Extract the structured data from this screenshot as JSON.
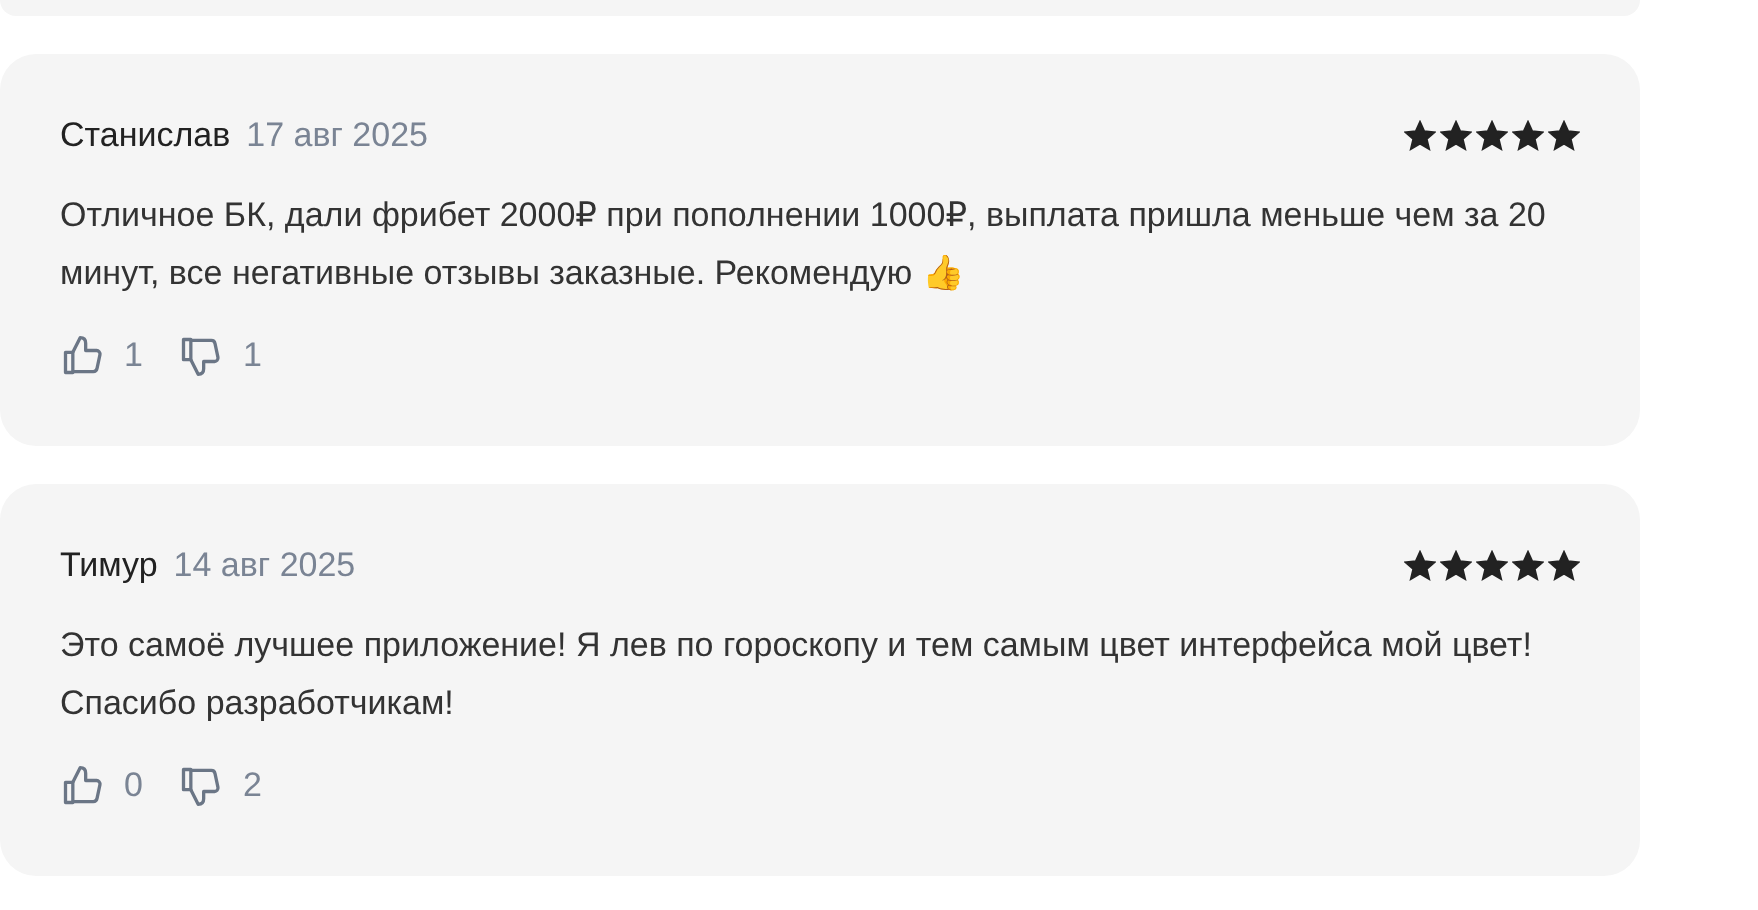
{
  "reviews": [
    {
      "author": "Станислав",
      "date": "17 авг 2025",
      "stars": 5,
      "text": "Отличное БК, дали фрибет 2000₽ при пополнении 1000₽, выплата пришла меньше чем за 20 минут, все негативные отзывы заказные. Рекомендую 👍",
      "likes": "1",
      "dislikes": "1"
    },
    {
      "author": "Тимур",
      "date": "14 авг 2025",
      "stars": 5,
      "text": "Это самоё лучшее приложение! Я лев по гороскопу и тем самым цвет интерфейса мой цвет! Спасибо разработчикам!",
      "likes": "0",
      "dislikes": "2"
    }
  ]
}
